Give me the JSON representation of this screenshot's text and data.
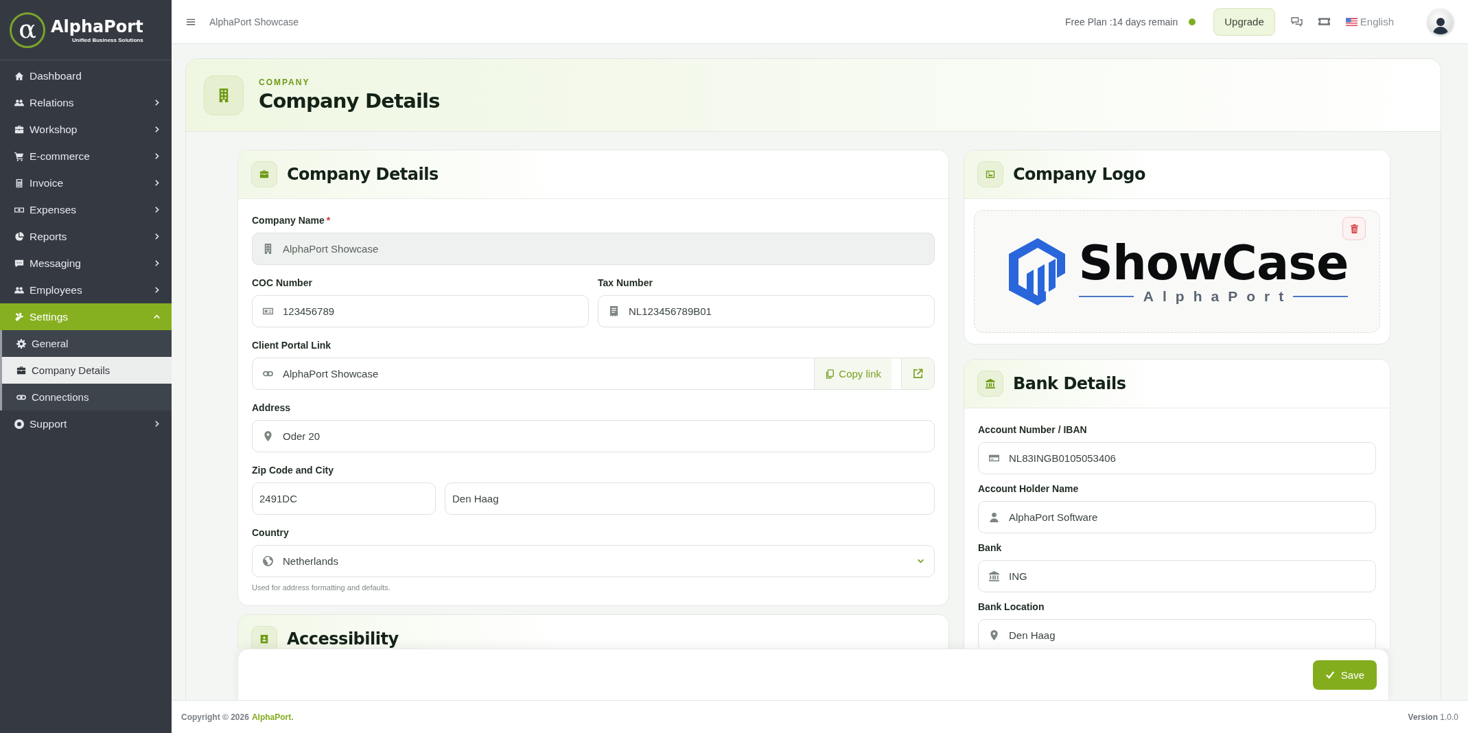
{
  "brand": {
    "mark": "α",
    "name": "AlphaPort",
    "tagline": "Unified Business Solutions"
  },
  "sidebar": {
    "items": [
      {
        "label": "Dashboard",
        "selected": false
      },
      {
        "label": "Relations",
        "expanded": false,
        "selected": false
      },
      {
        "label": "Workshop",
        "expanded": false,
        "selected": false
      },
      {
        "label": "E-commerce",
        "expanded": false,
        "selected": false
      },
      {
        "label": "Invoice",
        "expanded": false,
        "selected": false
      },
      {
        "label": "Expenses",
        "expanded": false,
        "selected": false
      },
      {
        "label": "Reports",
        "expanded": false,
        "selected": false
      },
      {
        "label": "Messaging",
        "expanded": false,
        "selected": false
      },
      {
        "label": "Employees",
        "expanded": false,
        "selected": false
      },
      {
        "label": "Settings",
        "expanded": true,
        "selected": true,
        "children": [
          {
            "label": "General",
            "selected": false
          },
          {
            "label": "Company Details",
            "selected": true
          },
          {
            "label": "Connections",
            "selected": false
          }
        ]
      },
      {
        "label": "Support",
        "expanded": false,
        "selected": false
      }
    ]
  },
  "topbar": {
    "title": "AlphaPort Showcase",
    "plan_status": "Free Plan :14 days remain",
    "plan_active": true,
    "upgrade_button": "Upgrade",
    "language": "English"
  },
  "page_header": {
    "eyebrow": "COMPANY",
    "title": "Company Details"
  },
  "company_details": {
    "title": "Company Details",
    "company_name": {
      "label": "Company Name",
      "required_mark": "*",
      "value": "AlphaPort Showcase",
      "disabled": true
    },
    "coc_number": {
      "label": "COC Number",
      "value": "123456789"
    },
    "tax_number": {
      "label": "Tax Number",
      "value": "NL123456789B01"
    },
    "client_portal_link": {
      "label": "Client Portal Link",
      "value": "AlphaPort Showcase",
      "copy_button": "Copy link"
    },
    "address": {
      "label": "Address",
      "value": "Oder 20"
    },
    "zip_city": {
      "label": "Zip Code and City",
      "zip": "2491DC",
      "city": "Den Haag"
    },
    "country": {
      "label": "Country",
      "value": "Netherlands",
      "help": "Used for address formatting and defaults."
    }
  },
  "accessibility": {
    "title": "Accessibility"
  },
  "company_logo": {
    "title": "Company Logo",
    "wordmark": "ShowCase",
    "tagline": "AlphaPort"
  },
  "bank_details": {
    "title": "Bank Details",
    "fields": [
      {
        "label": "Account Number / IBAN",
        "value": "NL83INGB0105053406"
      },
      {
        "label": "Account Holder Name",
        "value": "AlphaPort Software"
      },
      {
        "label": "Bank",
        "value": "ING"
      },
      {
        "label": "Bank Location",
        "value": "Den Haag"
      }
    ]
  },
  "save_button": "Save",
  "footer": {
    "copyright": "Copyright © 2026",
    "brand": "AlphaPort.",
    "version": "**Version** 1.0.0"
  }
}
